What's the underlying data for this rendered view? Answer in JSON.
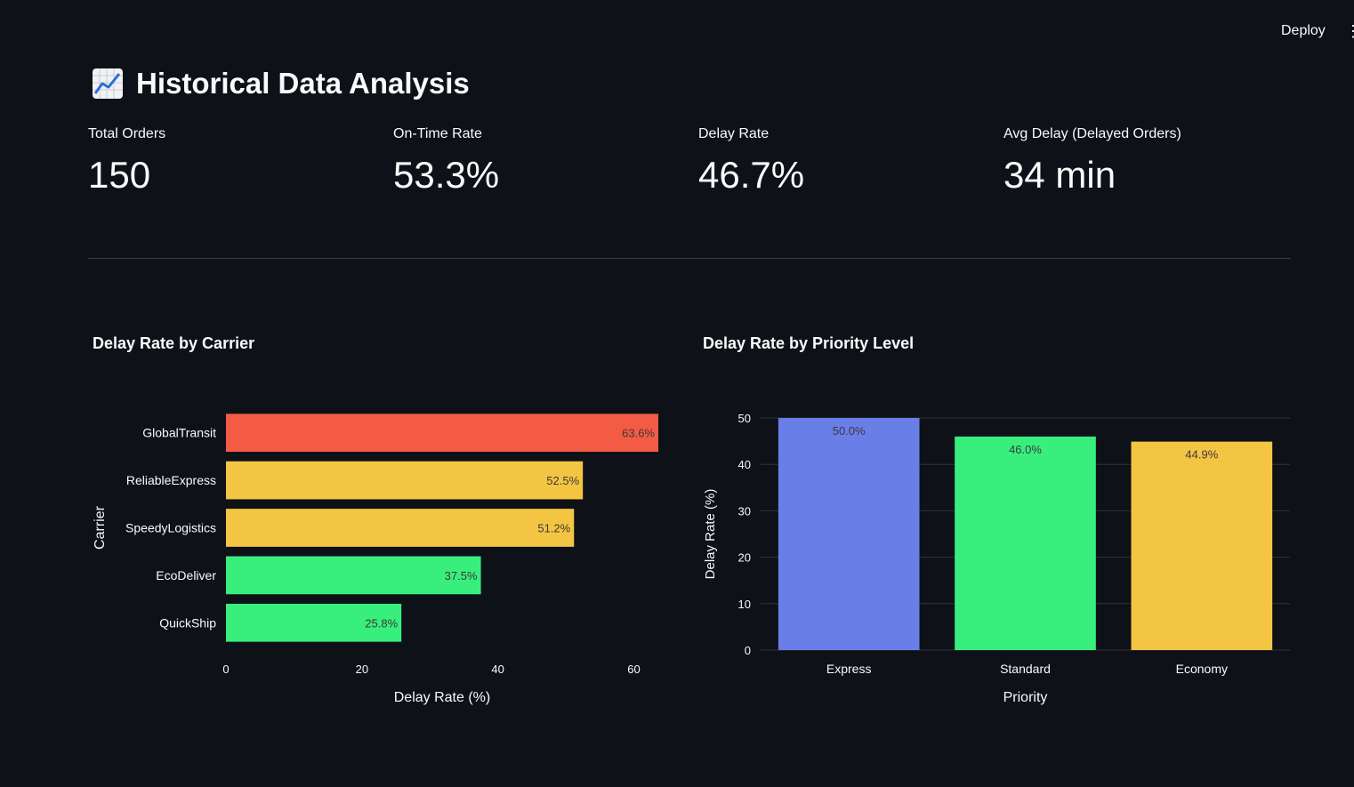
{
  "header": {
    "deploy_label": "Deploy",
    "menu_icon": "kebab-menu-icon"
  },
  "page": {
    "title": "Historical Data Analysis",
    "title_icon": "chart-increasing-icon"
  },
  "metrics": [
    {
      "label": "Total Orders",
      "value": "150"
    },
    {
      "label": "On-Time Rate",
      "value": "53.3%"
    },
    {
      "label": "Delay Rate",
      "value": "46.7%"
    },
    {
      "label": "Avg Delay (Delayed Orders)",
      "value": "34 min"
    }
  ],
  "colors": {
    "background": "#0e1117",
    "red": "#f45b45",
    "yellow": "#f4c542",
    "green": "#38ef7d",
    "blue": "#6a7ee8"
  },
  "chart_data": [
    {
      "type": "bar",
      "orientation": "horizontal",
      "title": "Delay Rate by Carrier",
      "xlabel": "Delay Rate (%)",
      "ylabel": "Carrier",
      "xlim": [
        0,
        63.6
      ],
      "xticks": [
        "0",
        "20",
        "40",
        "60"
      ],
      "grid": false,
      "categories": [
        "GlobalTransit",
        "ReliableExpress",
        "SpeedyLogistics",
        "EcoDeliver",
        "QuickShip"
      ],
      "values": [
        63.6,
        52.5,
        51.2,
        37.5,
        25.8
      ],
      "data_labels": [
        "63.6%",
        "52.5%",
        "51.2%",
        "37.5%",
        "25.8%"
      ],
      "colors": [
        "#f45b45",
        "#f4c542",
        "#f4c542",
        "#38ef7d",
        "#38ef7d"
      ]
    },
    {
      "type": "bar",
      "orientation": "vertical",
      "title": "Delay Rate by Priority Level",
      "xlabel": "Priority",
      "ylabel": "Delay Rate (%)",
      "ylim": [
        0,
        50
      ],
      "yticks": [
        "0",
        "10",
        "20",
        "30",
        "40",
        "50"
      ],
      "grid": true,
      "categories": [
        "Express",
        "Standard",
        "Economy"
      ],
      "values": [
        50.0,
        46.0,
        44.9
      ],
      "data_labels": [
        "50.0%",
        "46.0%",
        "44.9%"
      ],
      "colors": [
        "#6a7ee8",
        "#38ef7d",
        "#f4c542"
      ]
    }
  ]
}
